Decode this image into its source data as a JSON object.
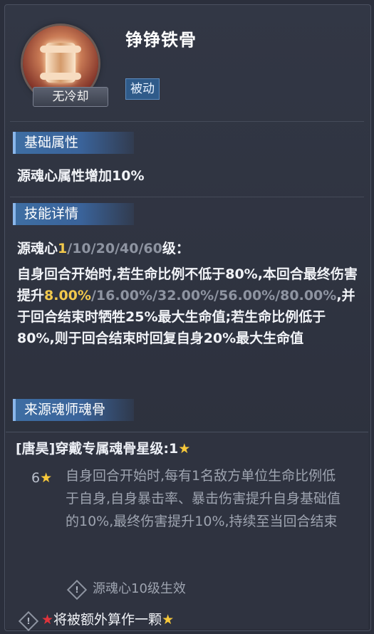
{
  "skill": {
    "name": "铮铮铁骨",
    "cooldown_label": "无冷却",
    "type_badge": "被动",
    "icon": "soul-bone-icon"
  },
  "basic_attr": {
    "header": "基础属性",
    "text": "源魂心属性增加10%"
  },
  "skill_detail": {
    "header": "技能详情",
    "level_prefix": "源魂心",
    "levels": [
      "1",
      "10",
      "20",
      "40",
      "60"
    ],
    "level_suffix": "级：",
    "desc_part1": "自身回合开始时,若生命比例不低于80%,本回合最终伤害提升",
    "values": [
      "8.00%",
      "16.00%",
      "32.00%",
      "56.00%",
      "80.00%"
    ],
    "desc_part2": ",并于回合结束时牺牲25%最大生命值;若生命比例低于80%,则于回合结束时回复自身20%最大生命值"
  },
  "source": {
    "header": "来源魂师魂骨",
    "title": "[唐昊]穿戴专属魂骨星级:1",
    "star_level": "6",
    "effect": "自身回合开始时,每有1名敌方单位生命比例低于自身,自身暴击率、暴击伤害提升自身基础值的10%,最终伤害提升10%,持续至当回合结束",
    "condition": "源魂心10级生效",
    "extra_note": "将被额外算作一颗"
  },
  "colors": {
    "highlight_value": "#f2c94c",
    "inactive_value": "#8e94a1",
    "section_header": "#3e6ea3",
    "star": "#f7c83a",
    "red_star": "#e0343c"
  }
}
